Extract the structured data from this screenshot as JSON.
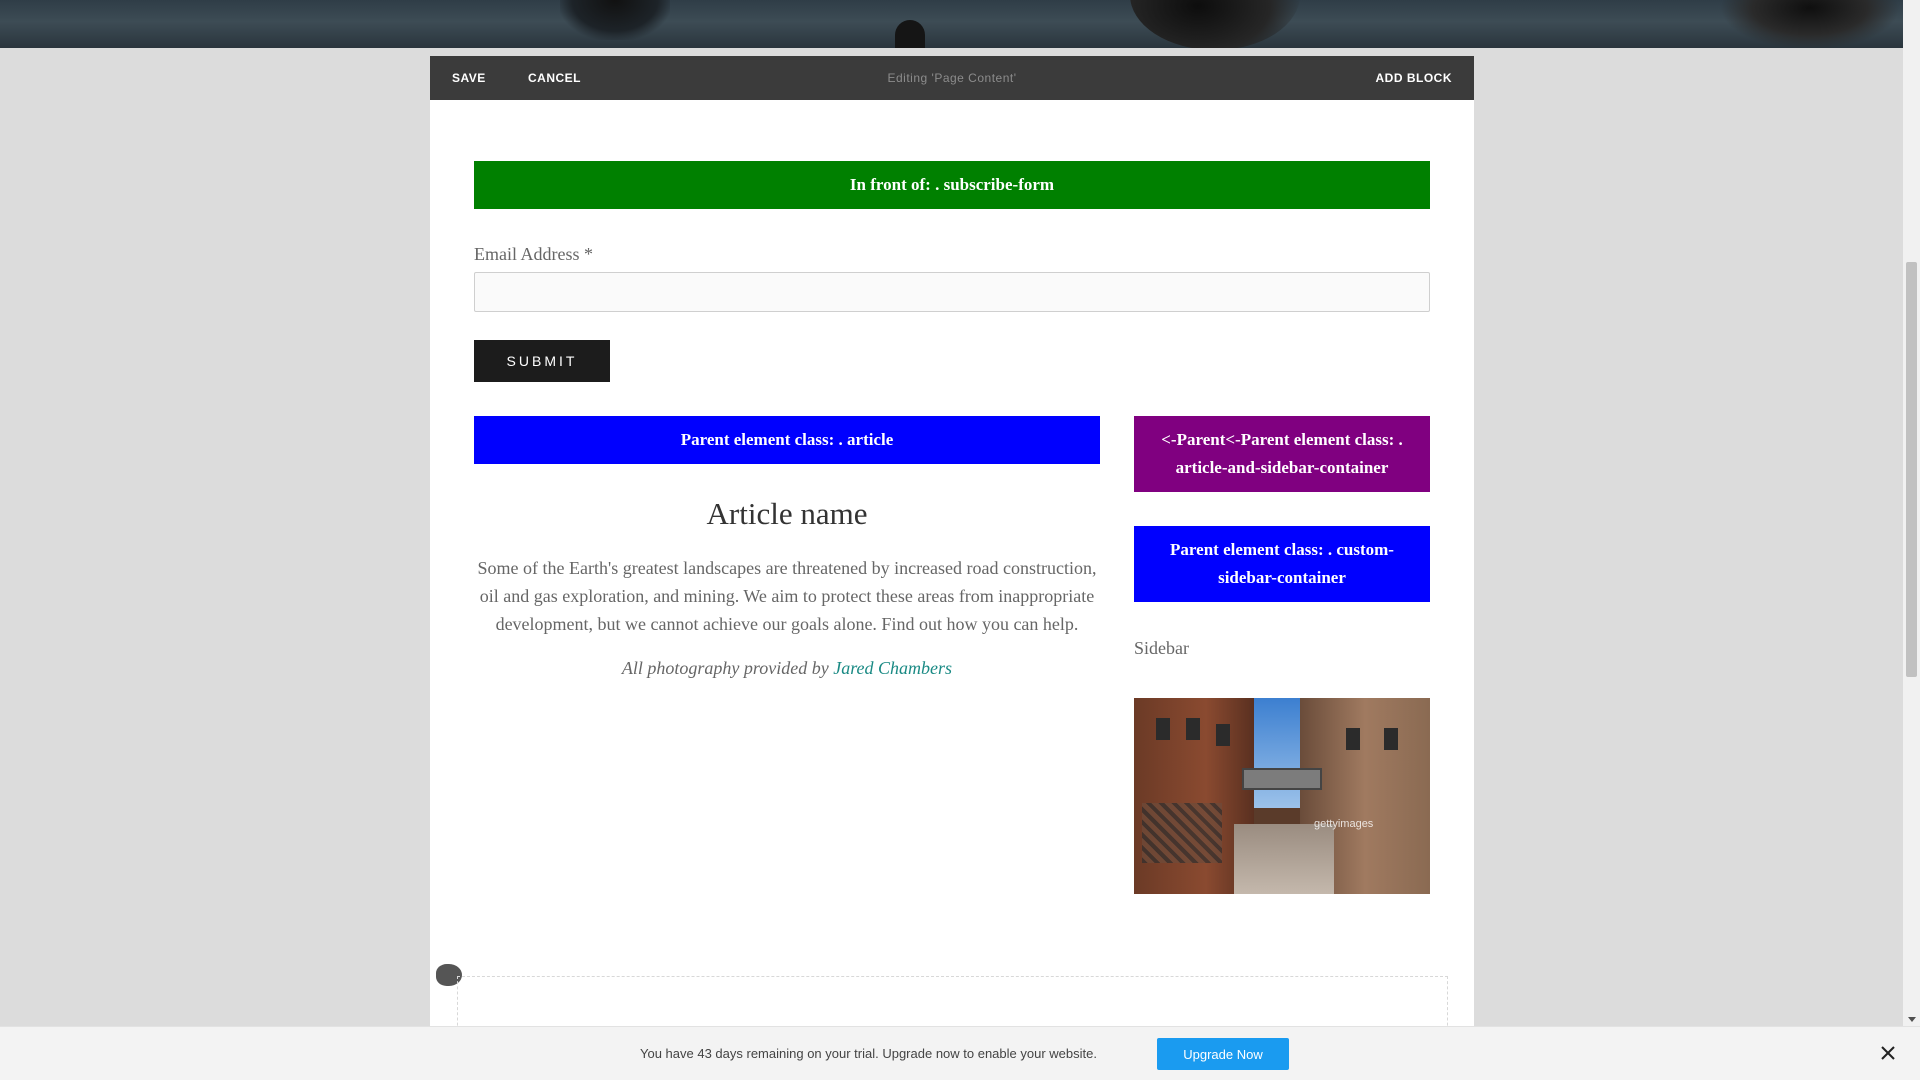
{
  "toolbar": {
    "save_label": "SAVE",
    "cancel_label": "CANCEL",
    "editing_label": "Editing 'Page Content'",
    "add_block_label": "ADD BLOCK"
  },
  "banners": {
    "front": "In front of: . subscribe-form",
    "article": "Parent element class: . article",
    "container": "<-Parent<-Parent element class: . article-and-sidebar-container",
    "sidebar_container": "Parent element class: . custom-sidebar-container"
  },
  "form": {
    "email_label": "Email Address *",
    "email_value": "",
    "email_placeholder": "",
    "submit_label": "SUBMIT"
  },
  "article": {
    "title": "Article name",
    "body": "Some of the Earth's greatest landscapes are threatened by increased road construction, oil and gas exploration, and mining. We aim to protect these areas from inappropriate development, but we cannot achieve our goals alone. Find out how you can help.",
    "credit_prefix": "All photography provided by ",
    "credit_link": "Jared Chambers"
  },
  "sidebar": {
    "label": "Sidebar",
    "image_watermark": "gettyimages"
  },
  "trial": {
    "message": "You have 43 days remaining on your trial. Upgrade now to enable your website.",
    "upgrade_label": "Upgrade Now"
  },
  "colors": {
    "toolbar": "#3b3b3b",
    "green_banner": "#008000",
    "blue_banner": "#0000ff",
    "purple_banner": "#800080",
    "upgrade_button": "#1a9bf0",
    "link": "#1a8a84"
  },
  "icons": {
    "close": "close-icon",
    "drag": "drag-handle-icon"
  }
}
